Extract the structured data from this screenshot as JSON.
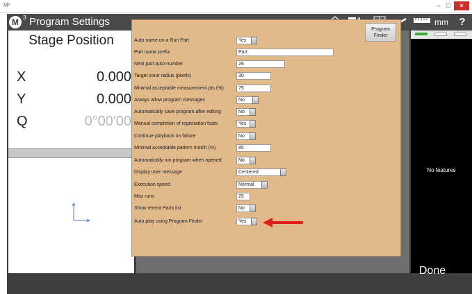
{
  "window": {
    "app_glyph": "M³",
    "minimize_label": "–",
    "maximize_label": "□",
    "close_label": "×"
  },
  "header": {
    "logo_text": "M",
    "logo_superscript": "3",
    "title": "Program Settings",
    "units": "mm",
    "help": "?"
  },
  "stage": {
    "title": "Stage Position",
    "axes": [
      {
        "label": "X",
        "value": "0.000"
      },
      {
        "label": "Y",
        "value": "0.000"
      },
      {
        "label": "Q",
        "value": "0°00'00"
      }
    ]
  },
  "settings": {
    "program_finder_label": "Program Finder",
    "rows": [
      {
        "label": "Auto name on a Run Part",
        "value": "Yes"
      },
      {
        "label": "Part name prefix",
        "value": "Part"
      },
      {
        "label": "Next part auto-number",
        "value": "26"
      },
      {
        "label": "Target zone radius (pixels)",
        "value": "30"
      },
      {
        "label": "Minimal acceptable measurement pts (%)",
        "value": "75"
      },
      {
        "label": "Always allow program messages",
        "value": "No"
      },
      {
        "label": "Automatically save program after editing",
        "value": "No"
      },
      {
        "label": "Manual completion of registration feats",
        "value": "Yes"
      },
      {
        "label": "Continue playback on failure",
        "value": "No"
      },
      {
        "label": "Minimal acceptable pattern match (%)",
        "value": "85"
      },
      {
        "label": "Automatically run program when opened",
        "value": "No"
      },
      {
        "label": "Display user message",
        "value": "Centered"
      },
      {
        "label": "Execution speed",
        "value": "Normal"
      },
      {
        "label": "Max runs",
        "value": "25"
      },
      {
        "label": "Show recent Parts list",
        "value": "No"
      },
      {
        "label": "Auto play using Program Finder",
        "value": "Yes"
      }
    ]
  },
  "features": {
    "empty_text": "No features"
  },
  "footer": {
    "done_label": "Done"
  },
  "colors": {
    "settings_bg": "#e2b98b",
    "app_bg": "#3a3a3a",
    "arrow": "#e11c1c",
    "tab_active": "#3ea83e"
  },
  "icons": [
    "home-icon",
    "video-icon",
    "grid-icon",
    "pencil-icon",
    "ruler-icon",
    "help-icon",
    "axes-icon",
    "arrow-icon"
  ]
}
